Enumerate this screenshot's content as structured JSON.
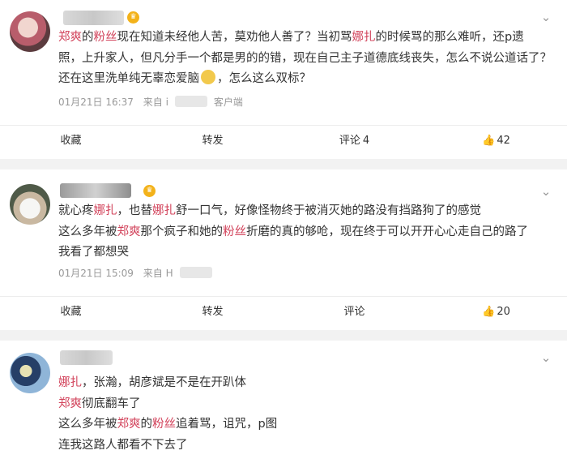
{
  "posts": [
    {
      "content": {
        "line1_parts": [
          "郑爽",
          "的",
          "粉丝",
          "现在知道未经他人苦，莫劝他人善了？当初骂",
          "娜扎",
          "的时候骂的那么难听，还p遗"
        ],
        "line2": "照，上升家人，但凡分手一个都是男的的错，现在自己主子道德底线丧失，怎么不说公道话了？",
        "line3_before": "还在这里洗单纯无辜恋爱脑",
        "line3_after": "，怎么这么双标？"
      },
      "meta": {
        "time": "01月21日 16:37",
        "source_prefix": "来自 i",
        "source_suffix": "客户端"
      },
      "actions": {
        "favorite": "收藏",
        "repost": "转发",
        "comment": "评论",
        "comment_count": "4",
        "like_count": "42"
      }
    },
    {
      "content": {
        "line1_parts": [
          "就心疼",
          "娜扎",
          "，也替",
          "娜扎",
          "舒一口气，好像怪物终于被消灭她的路没有挡路狗了的感觉"
        ],
        "line2_parts": [
          "这么多年被",
          "郑爽",
          "那个疯子和她的",
          "粉丝",
          "折磨的真的够呛，现在终于可以开开心心走自己的路了"
        ],
        "line3": "我看了都想哭"
      },
      "meta": {
        "time": "01月21日 15:09",
        "source_prefix": "来自 H"
      },
      "actions": {
        "favorite": "收藏",
        "repost": "转发",
        "comment": "评论",
        "like_count": "20"
      }
    },
    {
      "content": {
        "line1_parts": [
          "娜扎",
          "，张瀚，胡彦斌是不是在开趴体"
        ],
        "line2_parts": [
          "郑爽",
          "彻底翻车了"
        ],
        "line3_parts": [
          "这么多年被",
          "郑爽",
          "的",
          "粉丝",
          "追着骂，诅咒，p图"
        ],
        "line4": "连我这路人都看不下去了"
      }
    }
  ],
  "icons": {
    "vip": "crown-vip-icon",
    "more": "chevron-down-icon",
    "like": "thumbs-up-icon"
  },
  "colors": {
    "keyword": "#d2435b",
    "meta": "#999999",
    "background": "#f2f2f2"
  }
}
